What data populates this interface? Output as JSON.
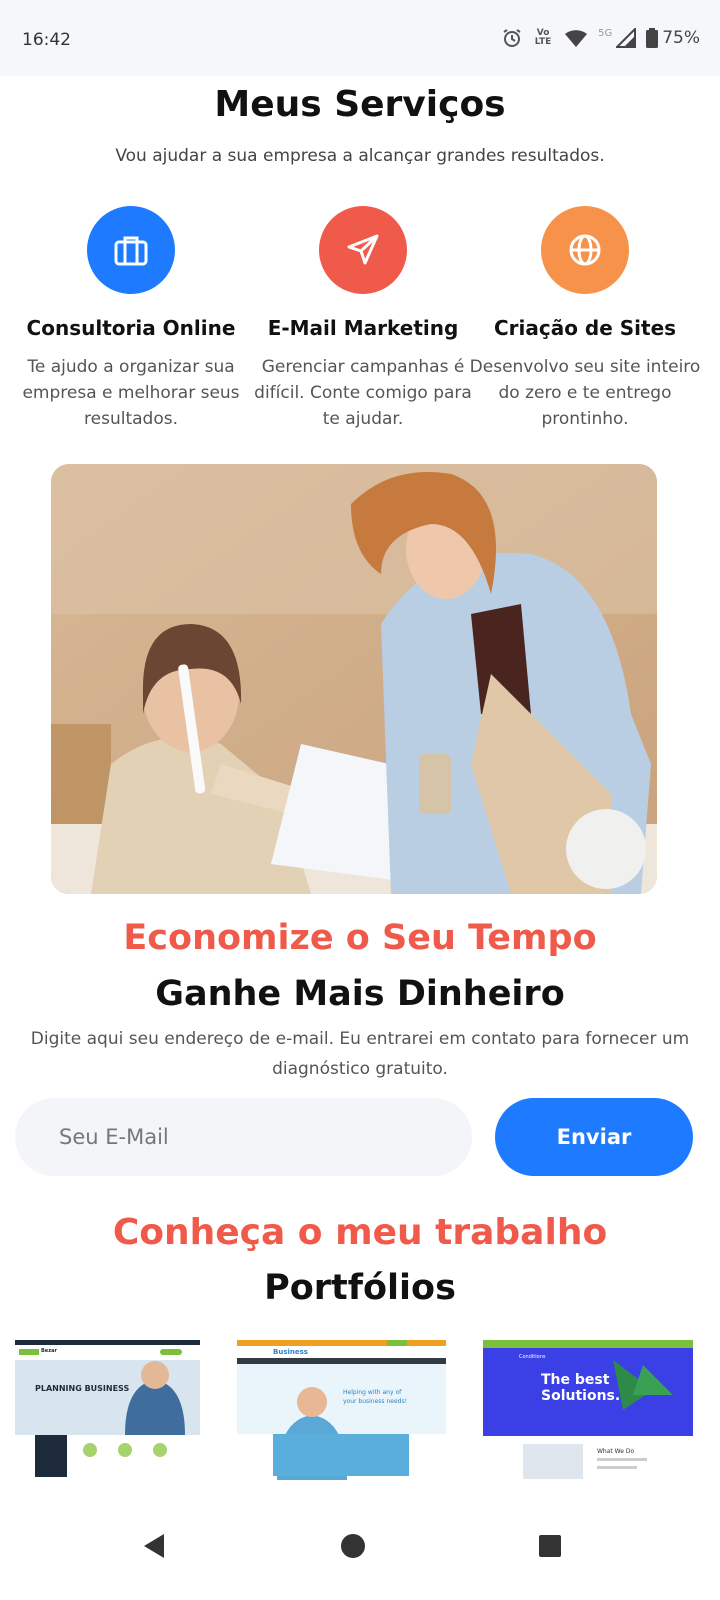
{
  "status_bar": {
    "time": "16:42",
    "battery": "75%",
    "network_label": "5G",
    "volte_label": "Vo LTE",
    "icons": [
      "alarm-icon",
      "volte-icon",
      "wifi-icon",
      "signal-icon",
      "battery-icon"
    ]
  },
  "services": {
    "title": "Meus Serviços",
    "subtitle": "Vou ajudar a sua empresa a alcançar grandes resultados.",
    "items": [
      {
        "name": "Consultoria Online",
        "description": "Te ajudo a organizar sua empresa e melhorar seus resultados.",
        "icon": "briefcase-icon",
        "color": "#1e7bff"
      },
      {
        "name": "E-Mail Marketing",
        "description": "Gerenciar campanhas é difícil. Conte comigo para te ajudar.",
        "icon": "send-icon",
        "color": "#f05a4a"
      },
      {
        "name": "Criação de Sites",
        "description": "Desenvolvo seu site inteiro do zero e te entrego prontinho.",
        "icon": "globe-icon",
        "color": "#f7924a"
      }
    ]
  },
  "newsletter": {
    "accent_title": "Economize o Seu Tempo",
    "title": "Ganhe Mais Dinheiro",
    "description": "Digite aqui seu endereço de e-mail. Eu entrarei em contato para fornecer um diagnóstico gratuito.",
    "input_placeholder": "Seu E-Mail",
    "button_label": "Enviar"
  },
  "portfolio": {
    "accent_title": "Conheça o meu trabalho",
    "title": "Portfólios",
    "items": [
      {
        "heading": "PLANNING BUSINESS",
        "brand": "Bezar"
      },
      {
        "heading": "Helping with any of your business needs!",
        "brand": "Business"
      },
      {
        "heading": "The best Solutions.",
        "subheading": "What We Do",
        "brand": "Conditions"
      }
    ]
  },
  "colors": {
    "accent_red": "#f05a4a",
    "primary_blue": "#1e7bff",
    "orange": "#f7924a"
  },
  "nav_bar": {
    "icons": [
      "back-icon",
      "home-icon",
      "recents-icon"
    ]
  }
}
